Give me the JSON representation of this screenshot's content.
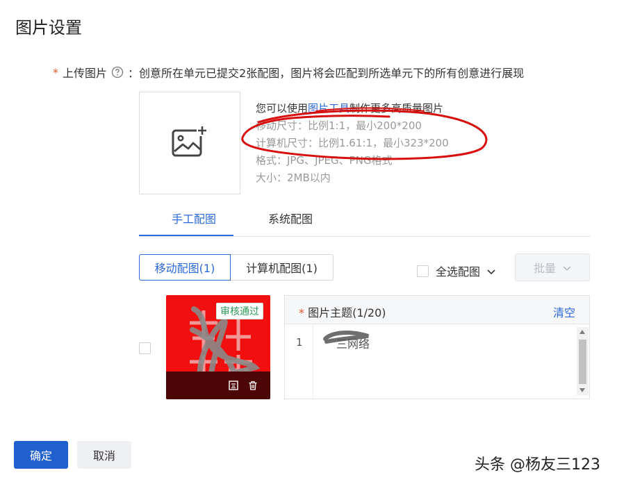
{
  "page": {
    "title": "图片设置"
  },
  "upload": {
    "required_mark": "*",
    "label": "上传图片",
    "hint": "：创意所在单元已提交2张配图，图片将会匹配到所选单元下的所有创意进行展现"
  },
  "tips": {
    "line1_prefix": "您可以使用",
    "line1_link": "图片工具",
    "line1_suffix": "制作更多高质量图片",
    "mobile_size": "移动尺寸：比例1:1，最小200*200",
    "pc_size": "计算机尺寸：比例1.61:1，最小323*200",
    "format": "格式：JPG、JPEG、PNG格式",
    "file_size": "大小：2MB以内"
  },
  "tabs": [
    {
      "label": "手工配图",
      "active": true
    },
    {
      "label": "系统配图",
      "active": false
    }
  ],
  "segments": [
    {
      "label": "移动配图(1)",
      "active": true
    },
    {
      "label": "计算机配图(1)",
      "active": false
    }
  ],
  "select_all": {
    "label": "全选配图"
  },
  "batch": {
    "label": "批量"
  },
  "image_item": {
    "badge": "审核通过",
    "bg_color": "#f20f0f"
  },
  "theme_panel": {
    "required_mark": "*",
    "title": "图片主题(1/20)",
    "clear_label": "清空",
    "line_number": "1",
    "line_text": "三网络"
  },
  "footer": {
    "ok_label": "确定",
    "cancel_label": "取消"
  },
  "watermark": "头条 @杨友三123",
  "colors": {
    "primary": "#2c69d8",
    "approved": "#2b9a59",
    "annotation": "#d80f0f"
  }
}
